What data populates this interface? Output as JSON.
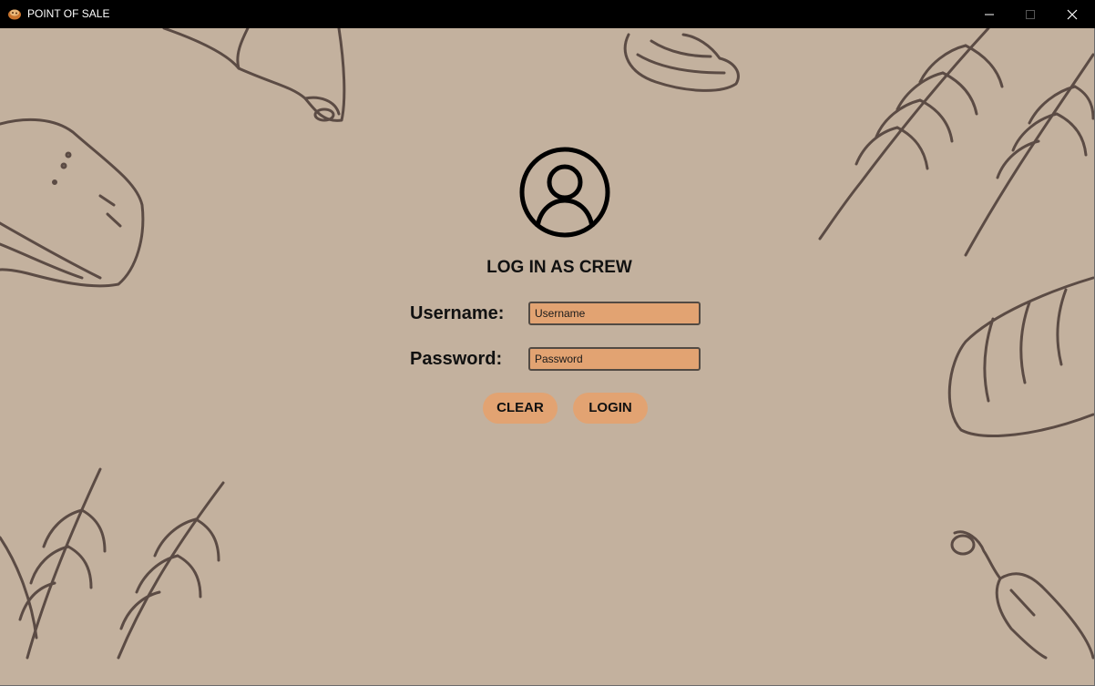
{
  "window": {
    "title": "POINT OF SALE",
    "app_icon": "bakery-icon",
    "controls": [
      "minimize-icon",
      "maximize-icon",
      "close-icon"
    ]
  },
  "login": {
    "user_icon": "user-circle-icon",
    "heading": "LOG IN AS CREW",
    "username_label": "Username:",
    "username_placeholder": "Username",
    "username_value": "",
    "password_label": "Password:",
    "password_placeholder": "Password",
    "password_value": "",
    "clear_label": "CLEAR",
    "login_label": "LOGIN"
  },
  "colors": {
    "background": "#c3b19e",
    "accent": "#e2a372",
    "sketch_stroke": "#5b4b44",
    "titlebar": "#000000"
  }
}
